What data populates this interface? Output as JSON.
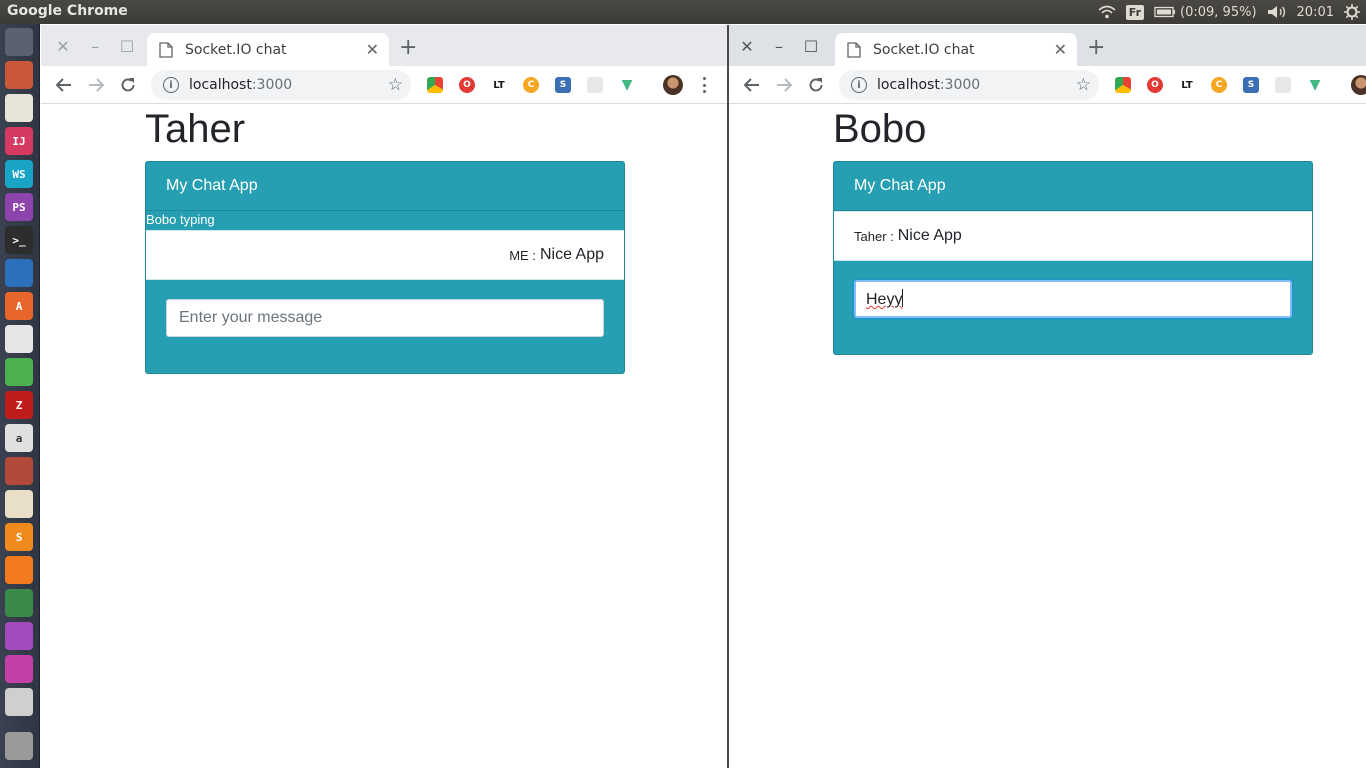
{
  "system": {
    "app_title": "Google Chrome",
    "keyboard_layout": "Fr",
    "battery": "(0:09, 95%)",
    "clock": "20:01"
  },
  "launcher": {
    "items": [
      {
        "name": "ubuntu-dash-icon",
        "color": "#5b6170"
      },
      {
        "name": "file-manager-icon",
        "color": "#c9573a"
      },
      {
        "name": "text-editor-icon",
        "color": "#e8e4d8"
      },
      {
        "name": "intellij-icon",
        "color": "#d63a62"
      },
      {
        "name": "webstorm-icon",
        "color": "#19a3c4"
      },
      {
        "name": "phpstorm-icon",
        "color": "#8e44ad"
      },
      {
        "name": "terminal-icon",
        "color": "#2d2d2d"
      },
      {
        "name": "vscode-icon",
        "color": "#2c6fbb"
      },
      {
        "name": "software-center-icon",
        "color": "#e8652b"
      },
      {
        "name": "evolution-icon",
        "color": "#e6e6e6"
      },
      {
        "name": "chrome-icon",
        "color": "#4caf50"
      },
      {
        "name": "filezilla-icon",
        "color": "#bf1d1d"
      },
      {
        "name": "amazon-icon",
        "color": "#e0e0e0"
      },
      {
        "name": "system-settings-icon",
        "color": "#b24a3b"
      },
      {
        "name": "document-viewer-icon",
        "color": "#e9dfc8"
      },
      {
        "name": "sublime-text-icon",
        "color": "#f08a1c"
      },
      {
        "name": "safari-compass-icon",
        "color": "#f27a1f"
      },
      {
        "name": "update-manager-icon",
        "color": "#3a8a4a"
      },
      {
        "name": "workspace-switcher-icon",
        "color": "#a34bbd"
      },
      {
        "name": "app-window-icon",
        "color": "#c240a8"
      },
      {
        "name": "drive-icon",
        "color": "#cfcfcf"
      },
      {
        "name": "trash-icon",
        "color": "#9a9a9a"
      }
    ]
  },
  "left_window": {
    "tab_title": "Socket.IO chat",
    "url_host": "localhost",
    "url_port": ":3000",
    "page": {
      "username": "Taher",
      "card_title": "My Chat App",
      "typing_status": "Bobo typing",
      "message_sender": "ME :",
      "message_text": "Nice App",
      "input_placeholder": "Enter your message",
      "input_value": ""
    }
  },
  "right_window": {
    "tab_title": "Socket.IO chat",
    "url_host": "localhost",
    "url_port": ":3000",
    "page": {
      "username": "Bobo",
      "card_title": "My Chat App",
      "message_sender": "Taher :",
      "message_text": "Nice App",
      "input_value": "Heyy"
    }
  },
  "colors": {
    "card_teal": "#279fb3",
    "focus_blue": "#80bdff"
  }
}
